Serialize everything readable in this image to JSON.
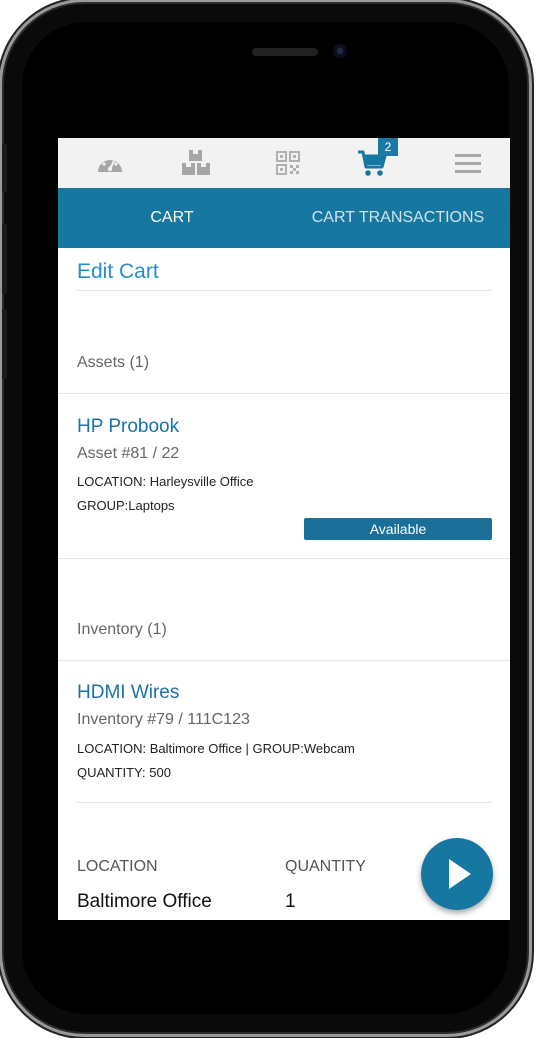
{
  "topbar": {
    "icons": [
      "dashboard-icon",
      "boxes-icon",
      "qr-code-icon",
      "cart-icon",
      "menu-icon"
    ],
    "cart_count": "2"
  },
  "tabs": {
    "cart": "CART",
    "transactions": "CART TRANSACTIONS"
  },
  "page": {
    "title": "Edit Cart"
  },
  "assets": {
    "header": "Assets (1)",
    "item": {
      "name": "HP Probook",
      "number": "Asset #81 / 22",
      "location": "LOCATION: Harleysville Office",
      "group": "GROUP:Laptops",
      "status": "Available"
    }
  },
  "inventory": {
    "header": "Inventory (1)",
    "item": {
      "name": "HDMI Wires",
      "number": "Inventory #79 / 111C123",
      "location_group": "LOCATION: Baltimore Office | GROUP:Webcam",
      "quantity": "QUANTITY: 500"
    },
    "table": {
      "location_header": "LOCATION",
      "quantity_header": "QUANTITY",
      "location_value": "Baltimore Office",
      "quantity_value": "1"
    }
  },
  "colors": {
    "primary": "#1677a0",
    "link": "#2b8dc7",
    "topbar": "#f2f2f2"
  }
}
